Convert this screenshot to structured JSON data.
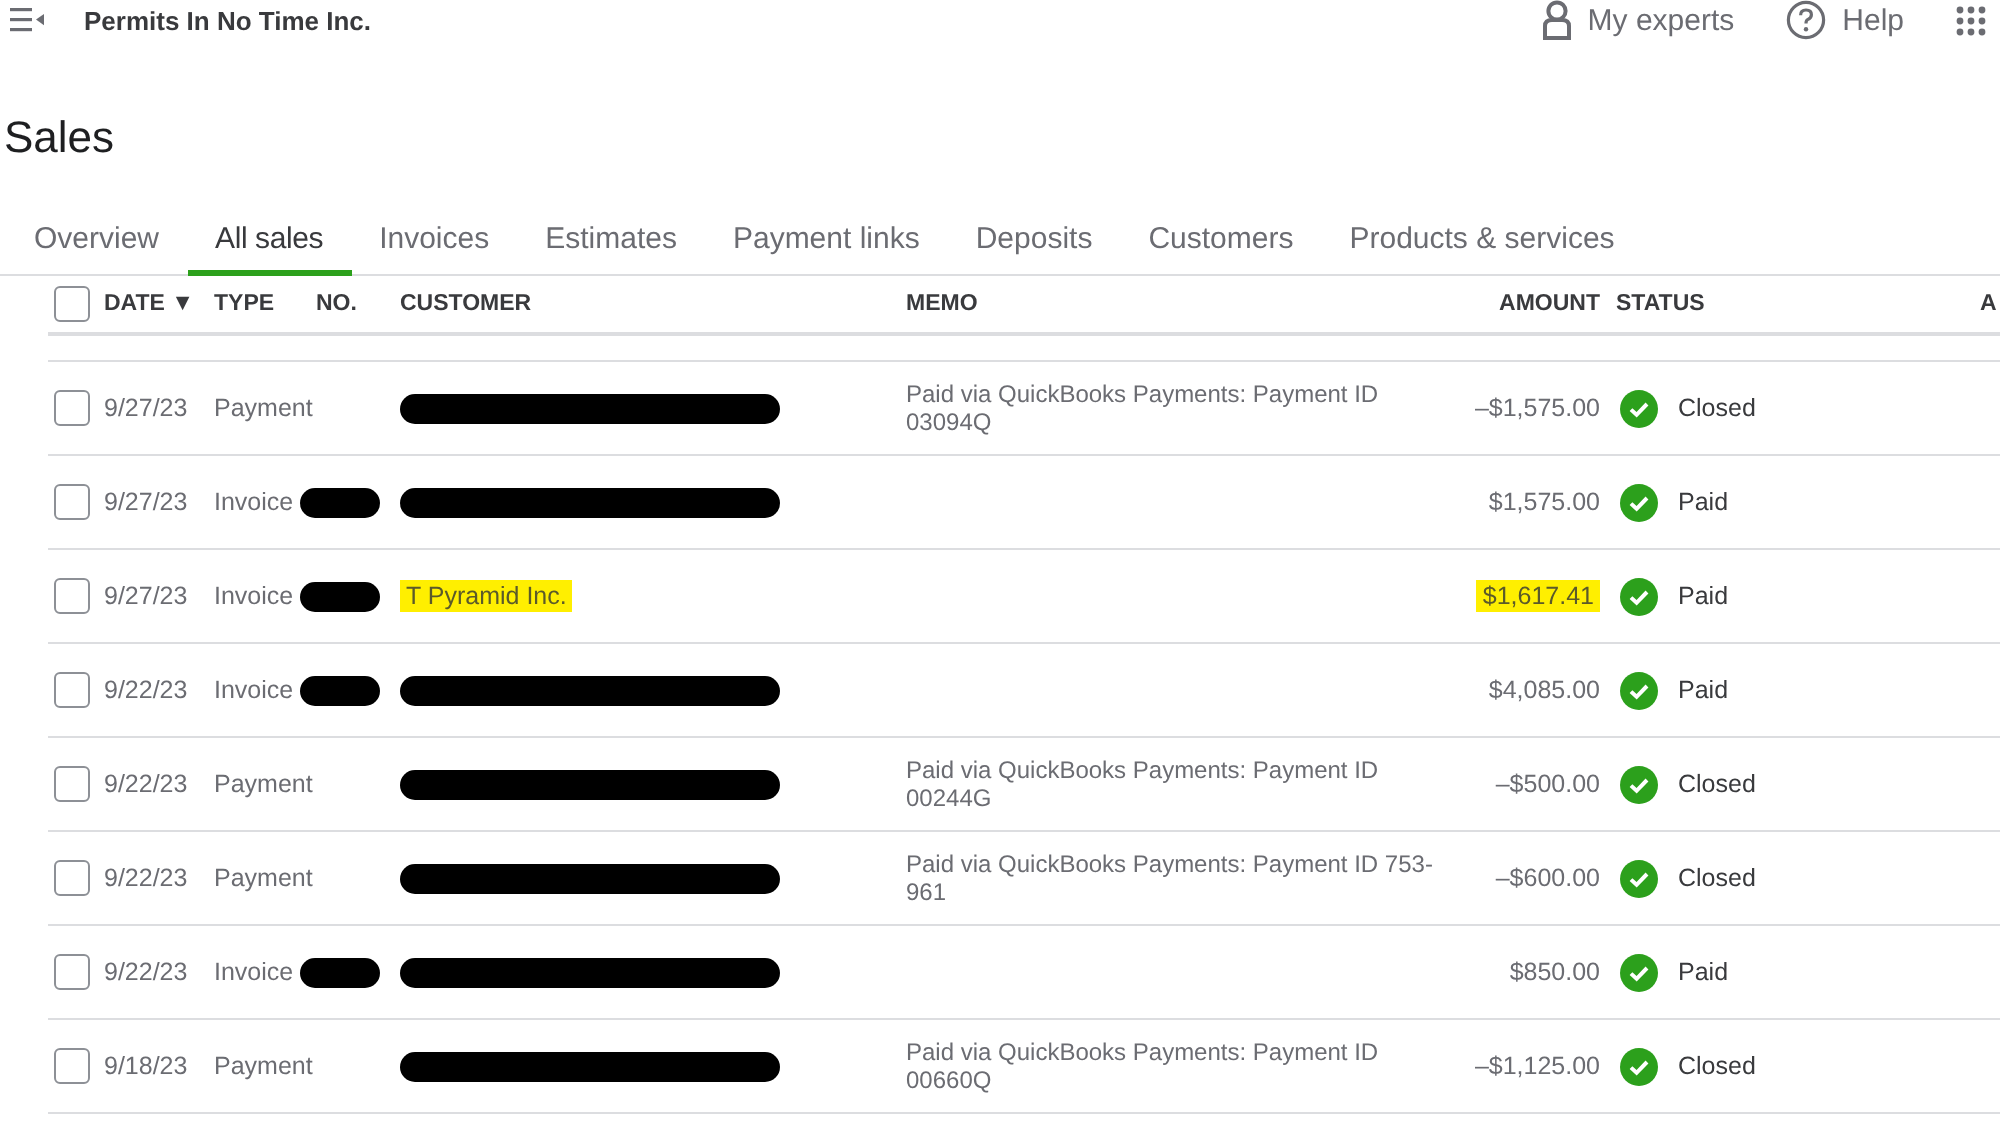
{
  "company": "Permits In No Time Inc.",
  "top_links": [
    {
      "kind": "experts",
      "label": "My experts"
    },
    {
      "kind": "help",
      "label": "Help"
    }
  ],
  "page_title": "Sales",
  "tabs": [
    {
      "label": "Overview",
      "selected": false
    },
    {
      "label": "All sales",
      "selected": true
    },
    {
      "label": "Invoices",
      "selected": false
    },
    {
      "label": "Estimates",
      "selected": false
    },
    {
      "label": "Payment links",
      "selected": false
    },
    {
      "label": "Deposits",
      "selected": false
    },
    {
      "label": "Customers",
      "selected": false
    },
    {
      "label": "Products & services",
      "selected": false
    }
  ],
  "table": {
    "columns": [
      "DATE",
      "TYPE",
      "NO.",
      "CUSTOMER",
      "MEMO",
      "AMOUNT",
      "STATUS",
      "A"
    ],
    "sort_indicator": "▼",
    "select_all_checked": false,
    "rows": [
      {
        "date": "9/27/23",
        "type": "Payment",
        "no_redacted": false,
        "customer_redacted": true,
        "memo": "Paid via QuickBooks Payments: Payment ID 03094Q",
        "amount": "–$1,575.00",
        "amount_highlighted": false,
        "status": "Closed",
        "checked": false
      },
      {
        "date": "9/27/23",
        "type": "Invoice",
        "no_redacted": true,
        "customer_redacted": true,
        "amount": "$1,575.00",
        "amount_highlighted": false,
        "status": "Paid",
        "checked": false
      },
      {
        "date": "9/27/23",
        "type": "Invoice",
        "no_redacted": true,
        "customer": "T Pyramid Inc.",
        "customer_highlighted": true,
        "customer_redacted": false,
        "amount": "$1,617.41",
        "amount_highlighted": true,
        "status": "Paid",
        "checked": false
      },
      {
        "date": "9/22/23",
        "type": "Invoice",
        "no_redacted": true,
        "customer_redacted": true,
        "amount": "$4,085.00",
        "amount_highlighted": false,
        "status": "Paid",
        "checked": false
      },
      {
        "date": "9/22/23",
        "type": "Payment",
        "no_redacted": false,
        "customer_redacted": true,
        "memo": "Paid via QuickBooks Payments: Payment ID 00244G",
        "amount": "–$500.00",
        "amount_highlighted": false,
        "status": "Closed",
        "checked": false
      },
      {
        "date": "9/22/23",
        "type": "Payment",
        "no_redacted": false,
        "customer_redacted": true,
        "memo": "Paid via QuickBooks Payments: Payment ID 753-961",
        "amount": "–$600.00",
        "amount_highlighted": false,
        "status": "Closed",
        "checked": false
      },
      {
        "date": "9/22/23",
        "type": "Invoice",
        "no_redacted": true,
        "customer_redacted": true,
        "amount": "$850.00",
        "amount_highlighted": false,
        "status": "Paid",
        "checked": false
      },
      {
        "date": "9/18/23",
        "type": "Payment",
        "no_redacted": false,
        "customer_redacted": true,
        "memo": "Paid via QuickBooks Payments: Payment ID 00660Q",
        "amount": "–$1,125.00",
        "amount_highlighted": false,
        "status": "Closed",
        "checked": false
      }
    ]
  }
}
